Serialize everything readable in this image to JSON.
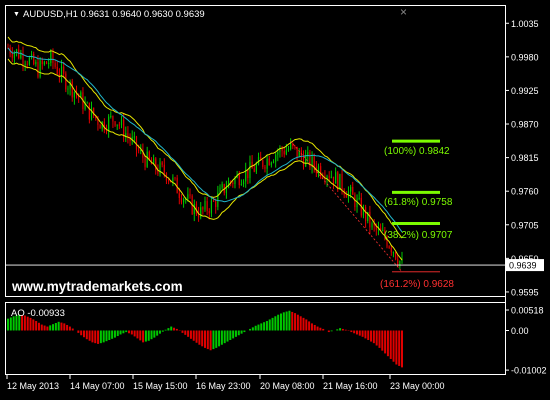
{
  "window": {
    "symbol_header": "AUDUSD,H1  0.9631 0.9640 0.9630 0.9639",
    "close_glyph": "×",
    "watermark": "www.mytrademarkets.com",
    "current_price_label": "0.9639"
  },
  "indicator_panel": {
    "label": "AO -0.00933"
  },
  "fib_labels": [
    {
      "text": "(100%) 0.9842",
      "color": "#7CFC00"
    },
    {
      "text": "(61.8%) 0.9758",
      "color": "#7CFC00"
    },
    {
      "text": "(38.2%) 0.9707",
      "color": "#7CFC00"
    },
    {
      "text": "(161.2%) 0.9628",
      "color": "#ff3030"
    }
  ],
  "colors": {
    "background": "#000000",
    "bull": "#00c800",
    "bear": "#e00000",
    "envelope": "#e6e600",
    "ma": "#20b4c8",
    "fib": "#7CFC00",
    "price_line": "#ffffff"
  },
  "chart_data": [
    {
      "type": "candlestick",
      "title": "AUDUSD,H1",
      "ylim": [
        0.959,
        1.006
      ],
      "y_ticks": [
        "1.0035",
        "0.9980",
        "0.9925",
        "0.9870",
        "0.9815",
        "0.9760",
        "0.9705",
        "0.9650",
        "0.9595"
      ],
      "x_ticks": [
        "12 May 2013",
        "14 May 07:00",
        "15 May 15:00",
        "16 May 23:00",
        "20 May 08:00",
        "21 May 16:00",
        "23 May 00:00"
      ],
      "close_path": [
        [
          0,
          0.9995
        ],
        [
          8,
          0.998
        ],
        [
          14,
          0.996
        ],
        [
          20,
          0.9975
        ],
        [
          26,
          0.9945
        ],
        [
          32,
          0.992
        ],
        [
          38,
          0.989
        ],
        [
          44,
          0.987
        ],
        [
          50,
          0.988
        ],
        [
          56,
          0.985
        ],
        [
          62,
          0.982
        ],
        [
          68,
          0.98
        ],
        [
          74,
          0.979
        ],
        [
          80,
          0.976
        ],
        [
          86,
          0.9735
        ],
        [
          90,
          0.9725
        ],
        [
          96,
          0.974
        ],
        [
          102,
          0.977
        ],
        [
          108,
          0.9785
        ],
        [
          114,
          0.9795
        ],
        [
          120,
          0.981
        ],
        [
          126,
          0.9825
        ],
        [
          132,
          0.983
        ],
        [
          138,
          0.9815
        ],
        [
          144,
          0.98
        ],
        [
          150,
          0.979
        ],
        [
          156,
          0.977
        ],
        [
          162,
          0.9745
        ],
        [
          166,
          0.9725
        ],
        [
          170,
          0.97
        ],
        [
          176,
          0.9685
        ],
        [
          180,
          0.9665
        ],
        [
          184,
          0.9639
        ]
      ],
      "current_price": 0.9639,
      "fib_levels": [
        0.9842,
        0.9758,
        0.9707,
        0.9628
      ]
    },
    {
      "type": "bar",
      "title": "AO",
      "value": -0.00933,
      "ylim": [
        -0.0105,
        0.0062
      ],
      "y_ticks": [
        "0.00518",
        "0.00",
        "-0.01002"
      ],
      "values": [
        0.003,
        0.0036,
        0.004,
        0.0038,
        0.0032,
        0.0024,
        0.0015,
        0.001,
        0.0016,
        0.0022,
        0.0018,
        0.001,
        0.0,
        -0.0012,
        -0.0022,
        -0.003,
        -0.0034,
        -0.003,
        -0.0024,
        -0.0018,
        -0.001,
        -0.0004,
        -0.001,
        -0.002,
        -0.003,
        -0.0026,
        -0.0018,
        -0.0008,
        0.0002,
        0.001,
        0.0004,
        -0.0006,
        -0.0016,
        -0.0026,
        -0.0036,
        -0.0044,
        -0.005,
        -0.0044,
        -0.0036,
        -0.0028,
        -0.002,
        -0.0012,
        -0.0004,
        0.0004,
        0.0012,
        0.0018,
        0.0024,
        0.0032,
        0.004,
        0.0046,
        0.005,
        0.0044,
        0.0036,
        0.0028,
        0.0018,
        0.001,
        0.0004,
        -0.0004,
        0.0,
        0.0006,
        0.0002,
        -0.0004,
        -0.001,
        -0.0016,
        -0.0024,
        -0.0032,
        -0.0044,
        -0.0058,
        -0.0072,
        -0.0086,
        -0.00933
      ]
    }
  ]
}
